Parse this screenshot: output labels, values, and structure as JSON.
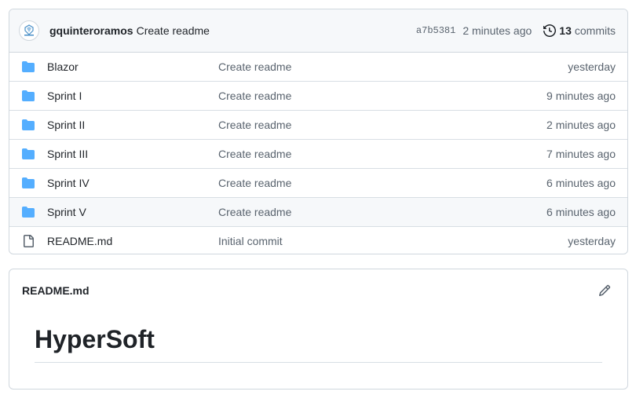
{
  "latest_commit": {
    "author": "gquinteroramos",
    "message": "Create readme",
    "sha": "a7b5381",
    "time": "2 minutes ago",
    "commit_count": "13",
    "commit_label": "commits"
  },
  "files": [
    {
      "name": "Blazor",
      "type": "folder",
      "commit": "Create readme",
      "time": "yesterday"
    },
    {
      "name": "Sprint I",
      "type": "folder",
      "commit": "Create readme",
      "time": "9 minutes ago"
    },
    {
      "name": "Sprint II",
      "type": "folder",
      "commit": "Create readme",
      "time": "2 minutes ago"
    },
    {
      "name": "Sprint III",
      "type": "folder",
      "commit": "Create readme",
      "time": "7 minutes ago"
    },
    {
      "name": "Sprint IV",
      "type": "folder",
      "commit": "Create readme",
      "time": "6 minutes ago"
    },
    {
      "name": "Sprint V",
      "type": "folder",
      "commit": "Create readme",
      "time": "6 minutes ago"
    },
    {
      "name": "README.md",
      "type": "file",
      "commit": "Initial commit",
      "time": "yesterday"
    }
  ],
  "readme": {
    "title": "README.md",
    "heading": "HyperSoft"
  },
  "colors": {
    "folder": "#54aeff",
    "muted_text": "#59636e",
    "border": "#d0d7de",
    "header_bg": "#f6f8fa"
  },
  "icons": {
    "folder": "folder-icon",
    "file": "file-icon",
    "history": "history-icon",
    "edit": "pencil-icon"
  }
}
